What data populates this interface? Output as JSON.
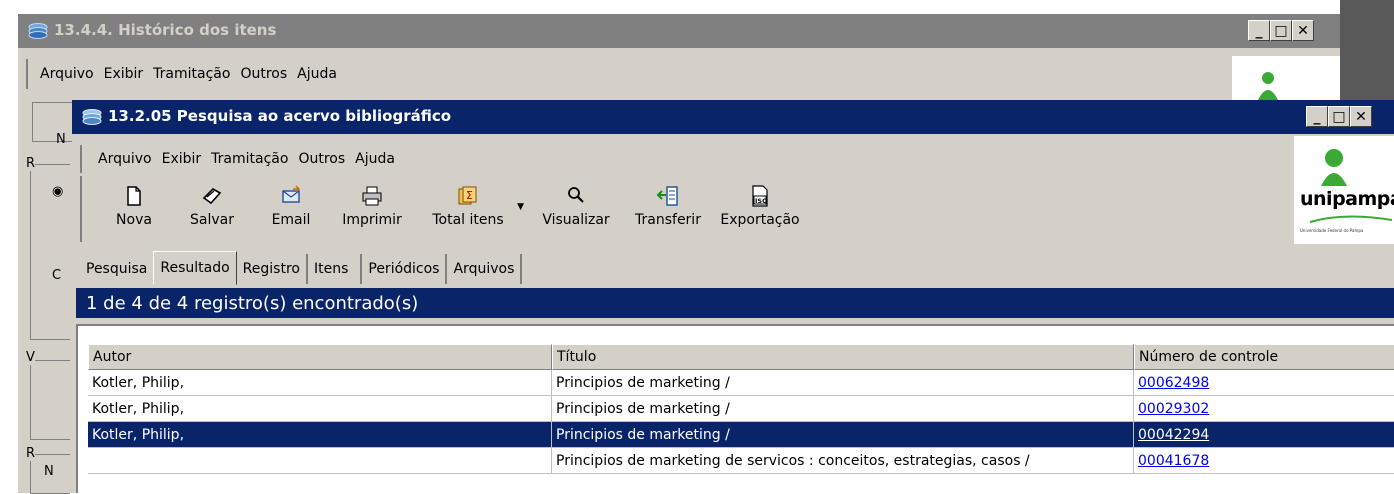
{
  "background_window": {
    "title": "13.4.4. Histórico dos itens",
    "menu": [
      "Arquivo",
      "Exibir",
      "Tramitação",
      "Outros",
      "Ajuda"
    ],
    "fragments": {
      "n": "N",
      "r1": "R",
      "c": "C",
      "v": "V",
      "r2": "R",
      "n2": "N"
    }
  },
  "foreground_window": {
    "title": "13.2.05 Pesquisa ao acervo bibliográfico",
    "menu": [
      "Arquivo",
      "Exibir",
      "Tramitação",
      "Outros",
      "Ajuda"
    ],
    "toolbar": [
      {
        "label": "Nova",
        "icon": "new-document-icon"
      },
      {
        "label": "Salvar",
        "icon": "save-icon"
      },
      {
        "label": "Email",
        "icon": "email-icon"
      },
      {
        "label": "Imprimir",
        "icon": "printer-icon"
      },
      {
        "label": "Total itens",
        "icon": "total-items-icon"
      },
      {
        "label": "Visualizar",
        "icon": "magnifier-icon"
      },
      {
        "label": "Transferir",
        "icon": "transfer-icon"
      },
      {
        "label": "Exportação",
        "icon": "iso-export-icon"
      }
    ],
    "logo_text": "unipampa",
    "logo_subtext": "Universidade Federal do Pampa",
    "tabs": [
      "Pesquisa",
      "Resultado",
      "Registro",
      "Itens",
      "Periódicos",
      "Arquivos"
    ],
    "active_tab": "Resultado",
    "status": "1 de 4 de 4 registro(s) encontrado(s)",
    "grid": {
      "columns": [
        "Autor",
        "Título",
        "Número de controle"
      ],
      "rows": [
        {
          "autor": "Kotler, Philip,",
          "titulo": "Principios de marketing /",
          "numero": "00062498"
        },
        {
          "autor": "Kotler, Philip,",
          "titulo": "Principios de marketing /",
          "numero": "00029302"
        },
        {
          "autor": "Kotler, Philip,",
          "titulo": "Principios de marketing /",
          "numero": "00042294"
        },
        {
          "autor": "",
          "titulo": "Principios de marketing de servicos : conceitos, estrategias, casos /",
          "numero": "00041678"
        }
      ],
      "selected_row": 2
    }
  },
  "window_controls": {
    "minimize": "_",
    "maximize": "□",
    "close": "✕"
  },
  "colors": {
    "titlebar_active": "#0a246a",
    "titlebar_inactive": "#808080",
    "face": "#d4d0c8",
    "link": "#0000ee",
    "logo_green": "#3aaa35"
  }
}
